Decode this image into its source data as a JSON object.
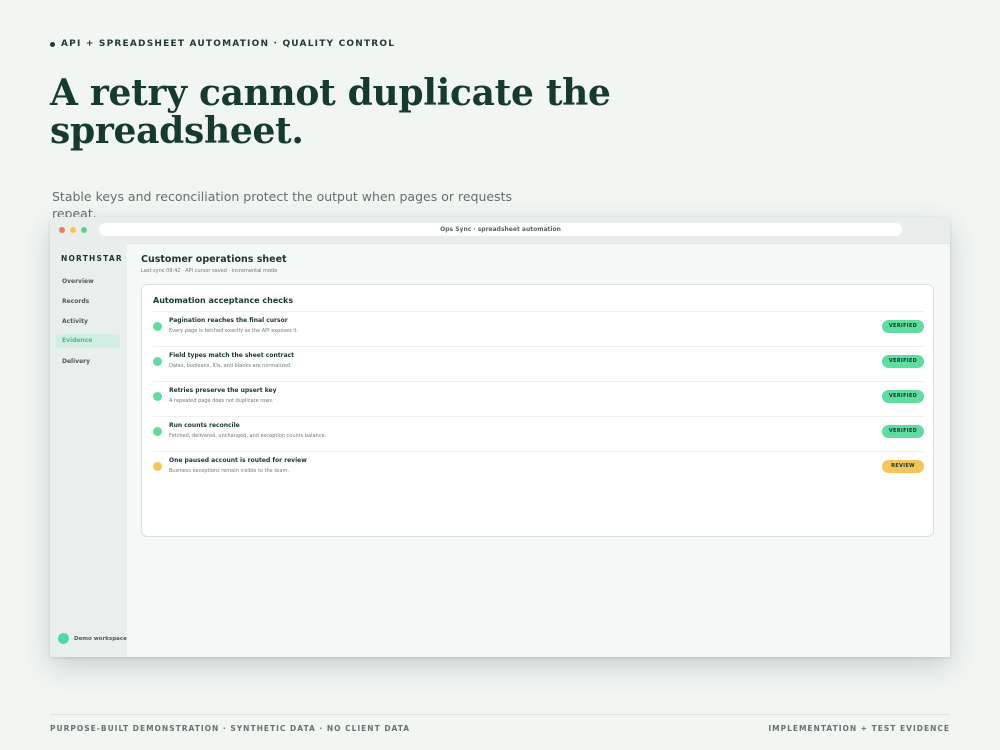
{
  "eyebrow": "API + SPREADSHEET AUTOMATION · QUALITY CONTROL",
  "headline": "A retry cannot duplicate the spreadsheet.",
  "subtitle": "Stable keys and reconciliation protect the output when pages or requests repeat.",
  "window": {
    "address": "Ops Sync · spreadsheet automation"
  },
  "sidebar": {
    "brand": "NORTHSTAR",
    "items": [
      {
        "label": "Overview",
        "active": false
      },
      {
        "label": "Records",
        "active": false
      },
      {
        "label": "Activity",
        "active": false
      },
      {
        "label": "Evidence",
        "active": true
      },
      {
        "label": "Delivery",
        "active": false
      }
    ],
    "workspace": "Demo workspace"
  },
  "main": {
    "title": "Customer operations sheet",
    "meta": "Last sync 09:42 · API cursor saved · incremental mode",
    "card": {
      "title": "Automation acceptance checks",
      "checks": [
        {
          "title": "Pagination reaches the final cursor",
          "description": "Every page is fetched exactly as the API exposes it.",
          "status": "VERIFIED"
        },
        {
          "title": "Field types match the sheet contract",
          "description": "Dates, booleans, IDs, and blanks are normalized.",
          "status": "VERIFIED"
        },
        {
          "title": "Retries preserve the upsert key",
          "description": "A repeated page does not duplicate rows.",
          "status": "VERIFIED"
        },
        {
          "title": "Run counts reconcile",
          "description": "Fetched, delivered, unchanged, and exception counts balance.",
          "status": "VERIFIED"
        },
        {
          "title": "One paused account is routed for review",
          "description": "Business exceptions remain visible to the team.",
          "status": "REVIEW"
        }
      ]
    }
  },
  "colors": {
    "verified": "#5fdc9f",
    "review": "#f5c55c",
    "accent": "#3fbf8a"
  },
  "footer": {
    "left": "PURPOSE-BUILT DEMONSTRATION · SYNTHETIC DATA · NO CLIENT DATA",
    "right": "IMPLEMENTATION + TEST EVIDENCE"
  }
}
